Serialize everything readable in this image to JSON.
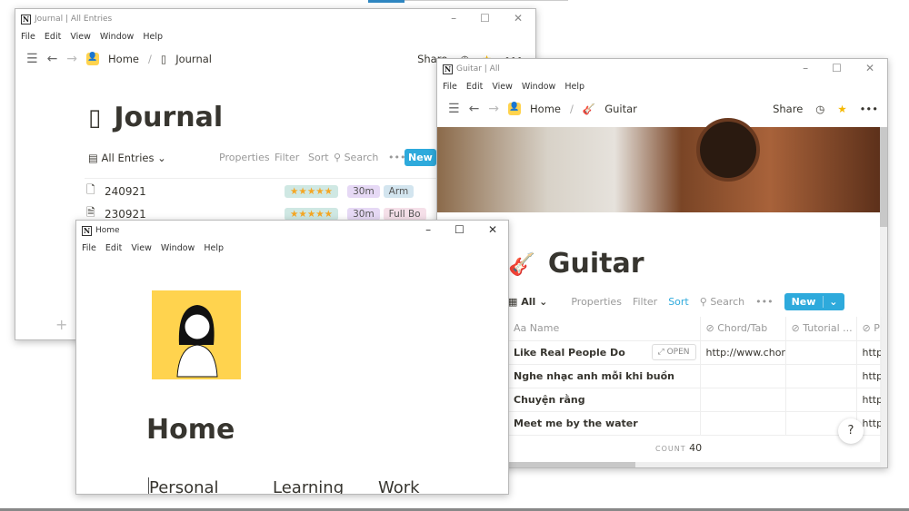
{
  "journal": {
    "title": "Journal | All Entries",
    "menu": [
      "File",
      "Edit",
      "View",
      "Window",
      "Help"
    ],
    "breadcrumb": [
      "Home",
      "Journal"
    ],
    "share": "Share",
    "page_title": "Journal",
    "view": "All Entries",
    "toolbar": {
      "properties": "Properties",
      "filter": "Filter",
      "sort": "Sort",
      "search": "Search",
      "more": "•••",
      "new": "New"
    },
    "rows": [
      {
        "name": "240921",
        "rating": "★★★★★",
        "duration": "30m",
        "tag": "Arm",
        "tag_color": "#d3e5ef"
      },
      {
        "name": "230921",
        "rating": "★★★★★",
        "duration": "30m",
        "tag": "Full Bo",
        "tag_color": "#f5e0e9"
      }
    ],
    "add": "+"
  },
  "guitar": {
    "title": "Guitar | All",
    "menu": [
      "File",
      "Edit",
      "View",
      "Window",
      "Help"
    ],
    "breadcrumb": [
      "Home",
      "Guitar"
    ],
    "share": "Share",
    "page_title": "Guitar",
    "view": "All",
    "toolbar": {
      "properties": "Properties",
      "filter": "Filter",
      "sort": "Sort",
      "search": "Search",
      "more": "•••",
      "new": "New"
    },
    "columns": [
      "Name",
      "Chord/Tab",
      "Tutorial ...",
      "P"
    ],
    "rows": [
      {
        "name": "Like Real People Do",
        "open": "OPEN",
        "chord": "http://www.chordi",
        "tutorial": "",
        "p": "http"
      },
      {
        "name": "Nghe nhạc anh mỗi khi buồn",
        "chord": "",
        "tutorial": "",
        "p": "http"
      },
      {
        "name": "Chuyện rằng",
        "chord": "",
        "tutorial": "",
        "p": "http"
      },
      {
        "name": "Meet me by the water",
        "chord": "",
        "tutorial": "",
        "p": "http"
      }
    ],
    "count_label": "COUNT",
    "count": "40",
    "help": "?"
  },
  "home": {
    "title": "Home",
    "menu": [
      "File",
      "Edit",
      "View",
      "Window",
      "Help"
    ],
    "page_title": "Home",
    "sections": [
      "Personal",
      "Learning",
      "Work"
    ]
  },
  "colors": {
    "accent": "#2eaadc",
    "star": "#f5a623",
    "avatar_bg": "#ffd34e"
  }
}
